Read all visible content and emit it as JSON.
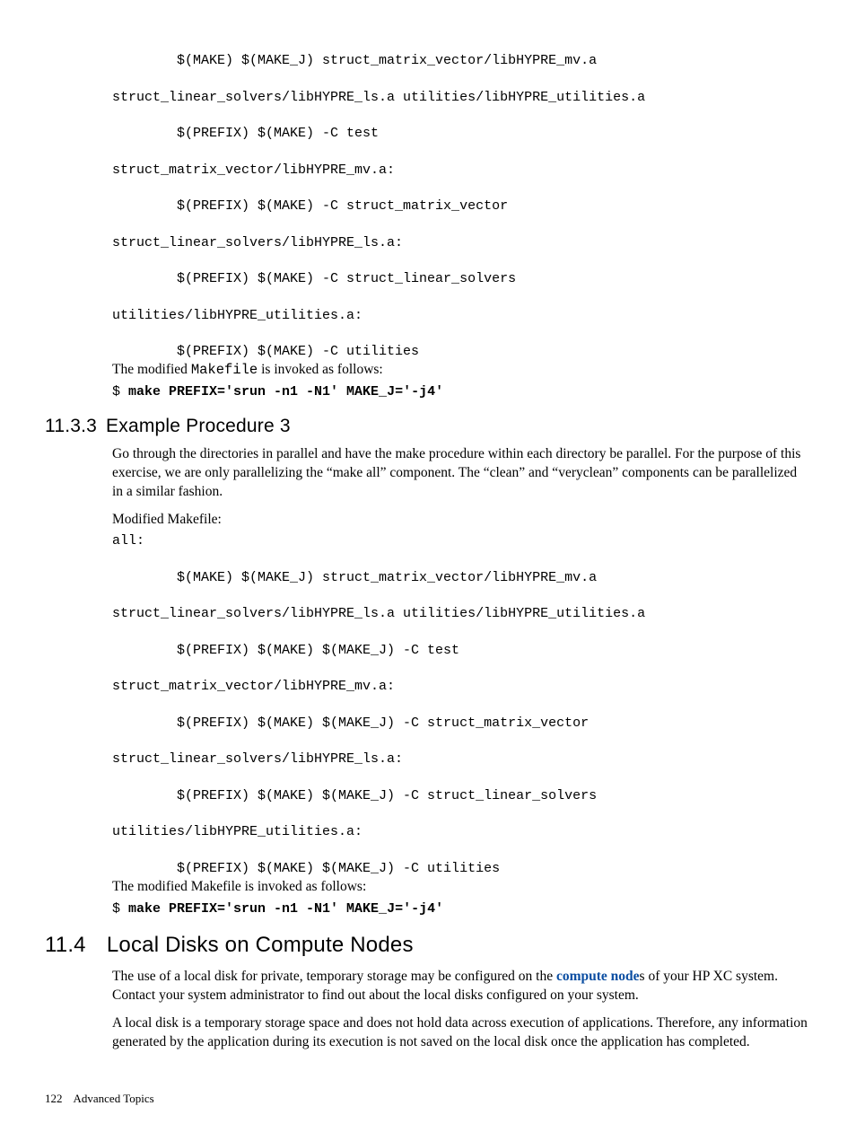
{
  "code_block_1": {
    "l1": "        $(MAKE) $(MAKE_J) struct_matrix_vector/libHYPRE_mv.a",
    "l2": "struct_linear_solvers/libHYPRE_ls.a utilities/libHYPRE_utilities.a",
    "l3": "        $(PREFIX) $(MAKE) -C test",
    "l4": "struct_matrix_vector/libHYPRE_mv.a:",
    "l5": "        $(PREFIX) $(MAKE) -C struct_matrix_vector",
    "l6": "struct_linear_solvers/libHYPRE_ls.a:",
    "l7": "        $(PREFIX) $(MAKE) -C struct_linear_solvers",
    "l8": "utilities/libHYPRE_utilities.a:",
    "l9": "        $(PREFIX) $(MAKE) -C utilities"
  },
  "para1_pre": "The modified ",
  "para1_code": "Makefile",
  "para1_post": " is invoked as follows:",
  "cmd1_prompt": "$ ",
  "cmd1_text": "make PREFIX='srun -n1 -N1' MAKE_J='-j4'",
  "sec_1133_num": "11.3.3",
  "sec_1133_title": "Example Procedure 3",
  "para2": "Go through the directories in parallel and have the make procedure within each directory be parallel. For the purpose of this exercise, we are only parallelizing the “make all” component. The “clean” and “veryclean” components can be parallelized in a similar fashion.",
  "para3": "Modified Makefile:",
  "code_block_2": {
    "l1": "all:",
    "l2": "        $(MAKE) $(MAKE_J) struct_matrix_vector/libHYPRE_mv.a",
    "l3": "struct_linear_solvers/libHYPRE_ls.a utilities/libHYPRE_utilities.a",
    "l4": "        $(PREFIX) $(MAKE) $(MAKE_J) -C test",
    "l5": "struct_matrix_vector/libHYPRE_mv.a:",
    "l6": "        $(PREFIX) $(MAKE) $(MAKE_J) -C struct_matrix_vector",
    "l7": "struct_linear_solvers/libHYPRE_ls.a:",
    "l8": "        $(PREFIX) $(MAKE) $(MAKE_J) -C struct_linear_solvers",
    "l9": "utilities/libHYPRE_utilities.a:",
    "l10": "        $(PREFIX) $(MAKE) $(MAKE_J) -C utilities"
  },
  "para4": "The modified Makefile is invoked as follows:",
  "cmd2_prompt": "$ ",
  "cmd2_text": "make PREFIX='srun -n1 -N1' MAKE_J='-j4'",
  "sec_114_num": "11.4",
  "sec_114_title": "Local Disks on Compute Nodes",
  "para5_pre": "The use of a local disk for private, temporary storage may be configured on the ",
  "para5_link": "compute node",
  "para5_post": "s of your HP XC system. Contact your system administrator to find out about the local disks configured on your system.",
  "para6": "A local disk is a temporary storage space and does not hold data across execution of applications. Therefore, any information generated by the application during its execution is not saved on the local disk once the application has completed.",
  "footer_page": "122",
  "footer_text": "Advanced Topics"
}
